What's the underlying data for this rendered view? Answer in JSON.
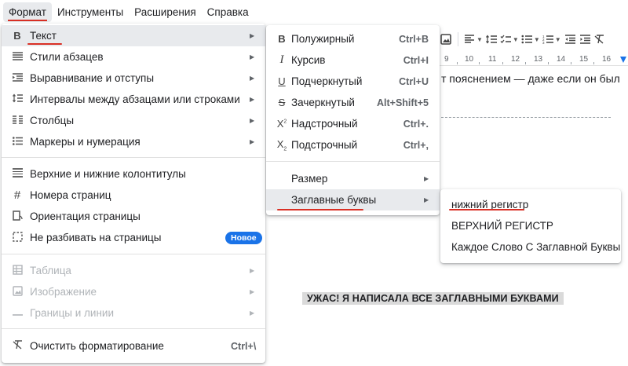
{
  "menubar": {
    "items": [
      "Формат",
      "Инструменты",
      "Расширения",
      "Справка"
    ]
  },
  "toolbar": {
    "ruler_ticks": [
      "9",
      "10",
      "11",
      "12",
      "13",
      "14",
      "15",
      "16"
    ]
  },
  "document": {
    "line1": "т пояснением — даже если он был",
    "caps_line": "УЖАС! Я НАПИСАЛА ВСЕ ЗАГЛАВНЫМИ БУКВАМИ"
  },
  "format_menu": {
    "items": [
      {
        "label": "Текст",
        "icon": "bold-b-icon",
        "submenu": true,
        "highlighted": true
      },
      {
        "label": "Стили абзацев",
        "icon": "paragraph-styles-icon",
        "submenu": true
      },
      {
        "label": "Выравнивание и отступы",
        "icon": "indent-icon",
        "submenu": true
      },
      {
        "label": "Интервалы между абзацами или строками",
        "icon": "line-spacing-icon",
        "submenu": true
      },
      {
        "label": "Столбцы",
        "icon": "columns-icon",
        "submenu": true
      },
      {
        "label": "Маркеры и нумерация",
        "icon": "bulleted-list-icon",
        "submenu": true
      },
      {
        "label": "Верхние и нижние колонтитулы",
        "icon": "header-footer-icon"
      },
      {
        "label": "Номера страниц",
        "icon": "hash-icon"
      },
      {
        "label": "Ориентация страницы",
        "icon": "page-orientation-icon"
      },
      {
        "label": "Не разбивать на страницы",
        "icon": "pageless-icon",
        "badge": "Новое"
      },
      {
        "label": "Таблица",
        "icon": "table-icon",
        "submenu": true,
        "disabled": true
      },
      {
        "label": "Изображение",
        "icon": "image-icon",
        "submenu": true,
        "disabled": true
      },
      {
        "label": "Границы и линии",
        "icon": "borders-icon",
        "submenu": true,
        "disabled": true
      },
      {
        "label": "Очистить форматирование",
        "icon": "clear-formatting-icon",
        "shortcut": "Ctrl+\\"
      }
    ]
  },
  "text_menu": {
    "items": [
      {
        "label": "Полужирный",
        "icon": "bold-icon",
        "shortcut": "Ctrl+B"
      },
      {
        "label": "Курсив",
        "icon": "italic-icon",
        "shortcut": "Ctrl+I"
      },
      {
        "label": "Подчеркнутый",
        "icon": "underline-icon",
        "shortcut": "Ctrl+U"
      },
      {
        "label": "Зачеркнутый",
        "icon": "strikethrough-icon",
        "shortcut": "Alt+Shift+5"
      },
      {
        "label": "Надстрочный",
        "icon": "superscript-icon",
        "shortcut": "Ctrl+."
      },
      {
        "label": "Подстрочный",
        "icon": "subscript-icon",
        "shortcut": "Ctrl+,"
      },
      {
        "label": "Размер",
        "submenu": true
      },
      {
        "label": "Заглавные буквы",
        "submenu": true,
        "highlighted": true
      }
    ]
  },
  "case_menu": {
    "items": [
      {
        "label": "нижний регистр",
        "highlighted": true
      },
      {
        "label": "ВЕРХНИЙ РЕГИСТР"
      },
      {
        "label": "Каждое Слово С Заглавной Буквы"
      }
    ]
  },
  "colors": {
    "highlight_underline": "#d93025",
    "badge": "#1a73e8",
    "hover": "#e8eaed"
  }
}
